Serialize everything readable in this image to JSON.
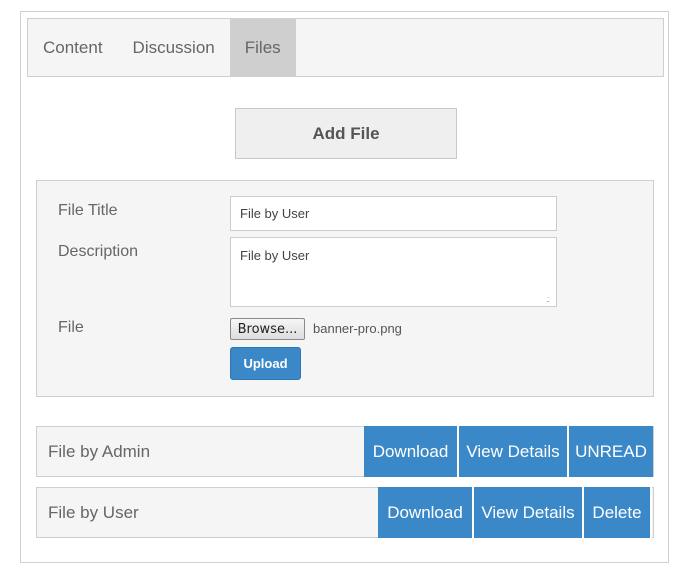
{
  "tabs": [
    {
      "label": "Content",
      "active": false
    },
    {
      "label": "Discussion",
      "active": false
    },
    {
      "label": "Files",
      "active": true
    }
  ],
  "add_file_label": "Add File",
  "form": {
    "title_label": "File Title",
    "title_value": "File by User",
    "description_label": "Description",
    "description_value": "File by User",
    "file_label": "File",
    "browse_label": "Browse...",
    "selected_file": "banner-pro.png",
    "upload_label": "Upload"
  },
  "files": [
    {
      "title": "File by Admin",
      "actions": [
        "Download",
        "View Details",
        "UNREAD"
      ]
    },
    {
      "title": "File by User",
      "actions": [
        "Download",
        "View Details",
        "Delete"
      ]
    }
  ],
  "colors": {
    "accent": "#3a88c8",
    "panel_bg": "#f5f5f5",
    "active_tab": "#cfcfcf"
  }
}
